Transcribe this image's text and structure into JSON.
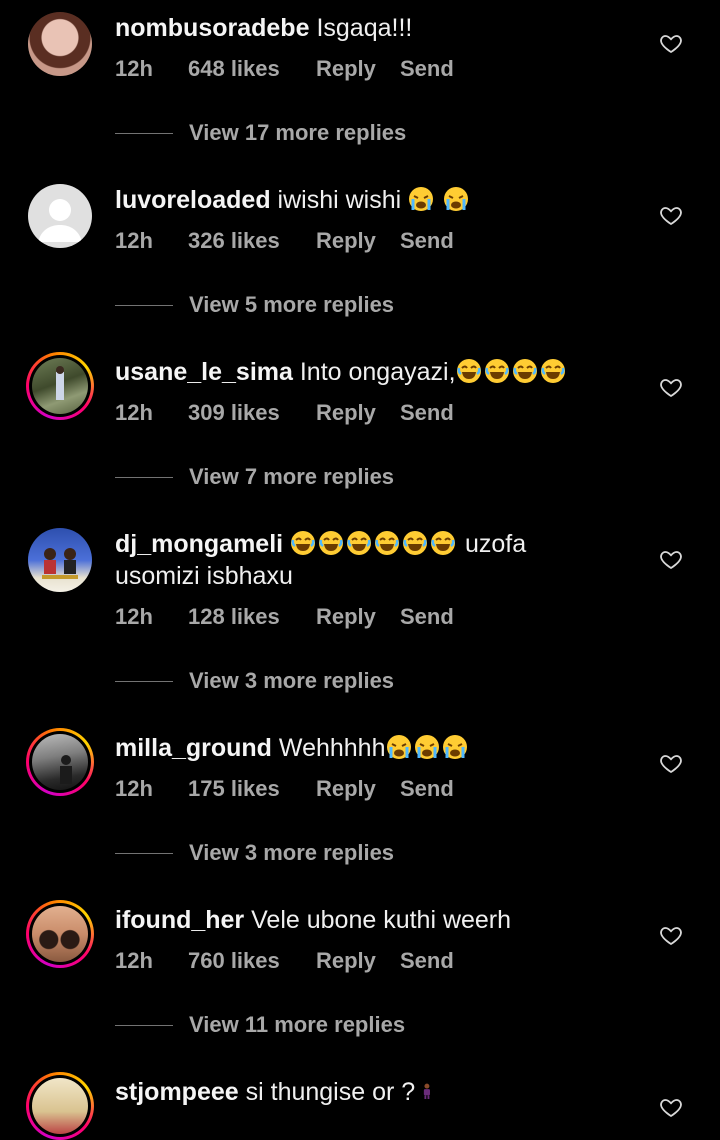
{
  "comments": [
    {
      "username": "nombusoradebe",
      "text": "Isgaqa!!!",
      "text2": "",
      "time": "12h",
      "likes": "648 likes",
      "reply": "Reply",
      "send": "Send",
      "view": "View 17 more replies",
      "emoji": []
    },
    {
      "username": "luvoreloaded",
      "text": "iwishi wishi",
      "text2": "",
      "time": "12h",
      "likes": "326 likes",
      "reply": "Reply",
      "send": "Send",
      "view": "View 5 more replies",
      "emoji": [
        "cry",
        "cry"
      ]
    },
    {
      "username": "usane_le_sima",
      "text": "Into ongayazi,",
      "text2": "",
      "time": "12h",
      "likes": "309 likes",
      "reply": "Reply",
      "send": "Send",
      "view": "View 7 more replies",
      "emoji": [
        "laugh",
        "laugh",
        "laugh",
        "laugh"
      ]
    },
    {
      "username": "dj_mongameli",
      "text": "uzofa",
      "text2": "usomizi isbhaxu",
      "time": "12h",
      "likes": "128 likes",
      "reply": "Reply",
      "send": "Send",
      "view": "View 3 more replies",
      "emoji": [
        "laugh",
        "laugh",
        "laugh",
        "laugh",
        "laugh",
        "laugh"
      ]
    },
    {
      "username": "milla_ground",
      "text": "Wehhhhh",
      "text2": "",
      "time": "12h",
      "likes": "175 likes",
      "reply": "Reply",
      "send": "Send",
      "view": "View 3 more replies",
      "emoji": [
        "cry",
        "cry",
        "cry"
      ]
    },
    {
      "username": "ifound_her",
      "text": "Vele ubone kuthi  weerh",
      "text2": "",
      "time": "12h",
      "likes": "760 likes",
      "reply": "Reply",
      "send": "Send",
      "view": "View 11 more replies",
      "emoji": []
    },
    {
      "username": "stjompeee",
      "text": "si thungise or ?",
      "text2": "",
      "time": "",
      "likes": "",
      "reply": "",
      "send": "",
      "view": "",
      "emoji": [
        "person"
      ]
    }
  ],
  "icons": {
    "like": "heart-outline-icon",
    "laugh_emoji": "face-with-tears-of-joy",
    "cry_emoji": "loudly-crying-face"
  },
  "colors": {
    "background": "#000000",
    "text": "#f5f5f5",
    "secondary": "#a8a8a8"
  }
}
